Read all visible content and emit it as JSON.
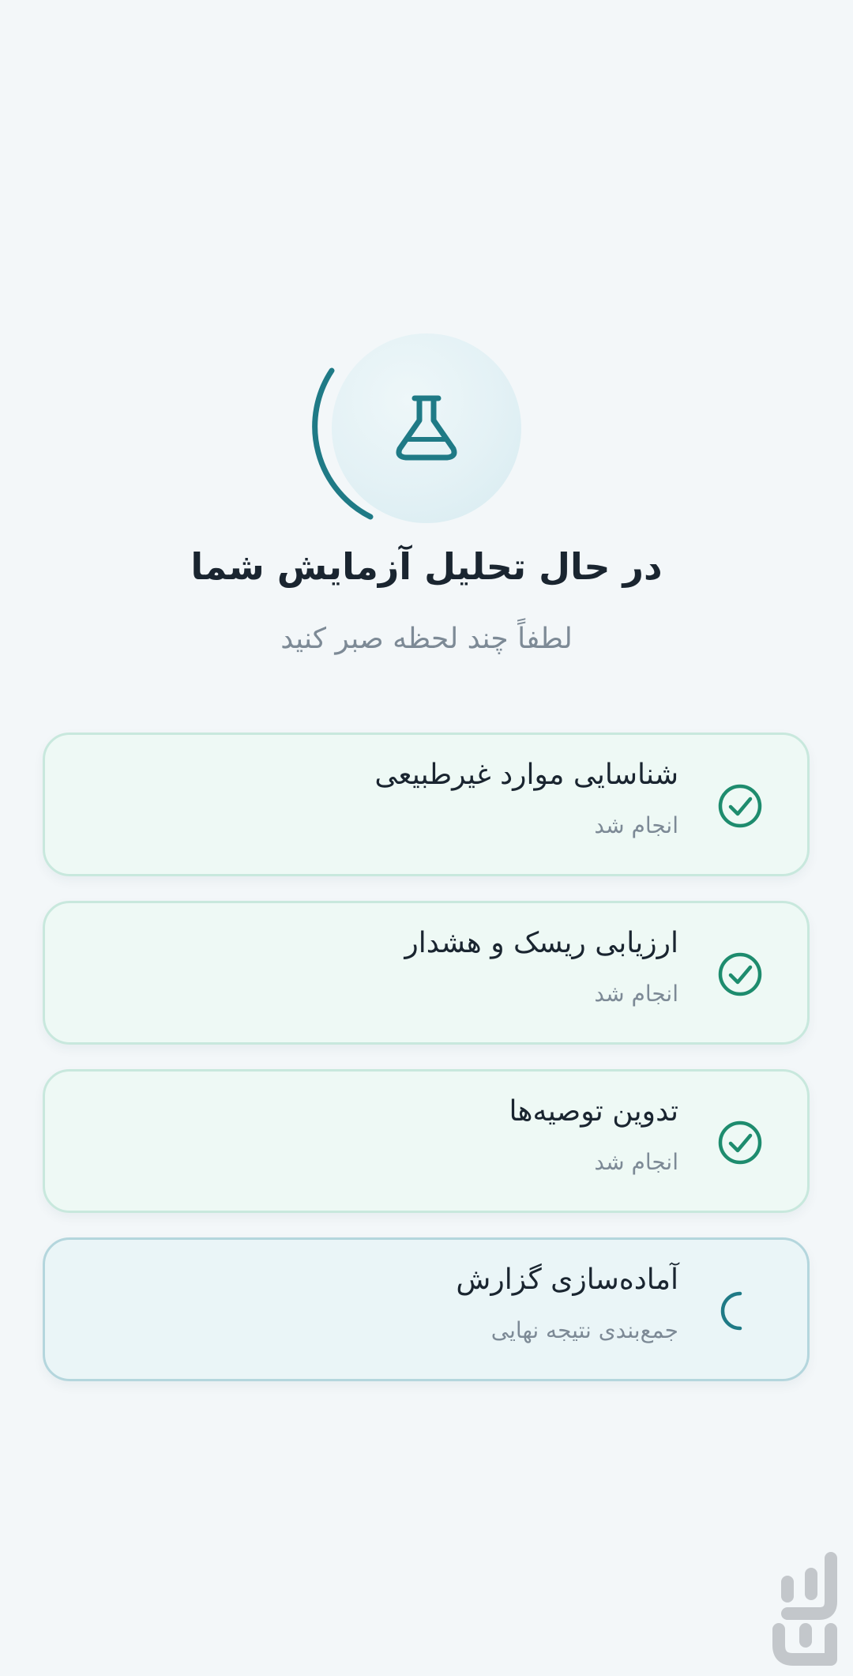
{
  "header": {
    "title": "در حال تحلیل آزمایش شما",
    "subtitle": "لطفاً چند لحظه صبر کنید"
  },
  "hero": {
    "icon": "flask-icon",
    "spinner": "loading-arc"
  },
  "steps": [
    {
      "title": "شناسایی موارد غیرطبیعی",
      "status_text": "انجام شد",
      "state": "done",
      "icon": "check-circle-icon"
    },
    {
      "title": "ارزیابی ریسک و هشدار",
      "status_text": "انجام شد",
      "state": "done",
      "icon": "check-circle-icon"
    },
    {
      "title": "تدوین توصیه‌ها",
      "status_text": "انجام شد",
      "state": "done",
      "icon": "check-circle-icon"
    },
    {
      "title": "آماده‌سازی گزارش",
      "status_text": "جمع‌بندی نتیجه نهایی",
      "state": "in-progress",
      "icon": "spinner-icon"
    }
  ],
  "colors": {
    "background": "#f3f7f9",
    "accent_teal": "#1f7a86",
    "success_green": "#1e8c6e",
    "text_primary": "#1a2530",
    "text_secondary": "#7d8a96",
    "card_done_bg": "#eef9f5",
    "card_pending_bg": "#eaf5f7"
  },
  "watermark": {
    "icon": "app-store-logo-icon"
  }
}
